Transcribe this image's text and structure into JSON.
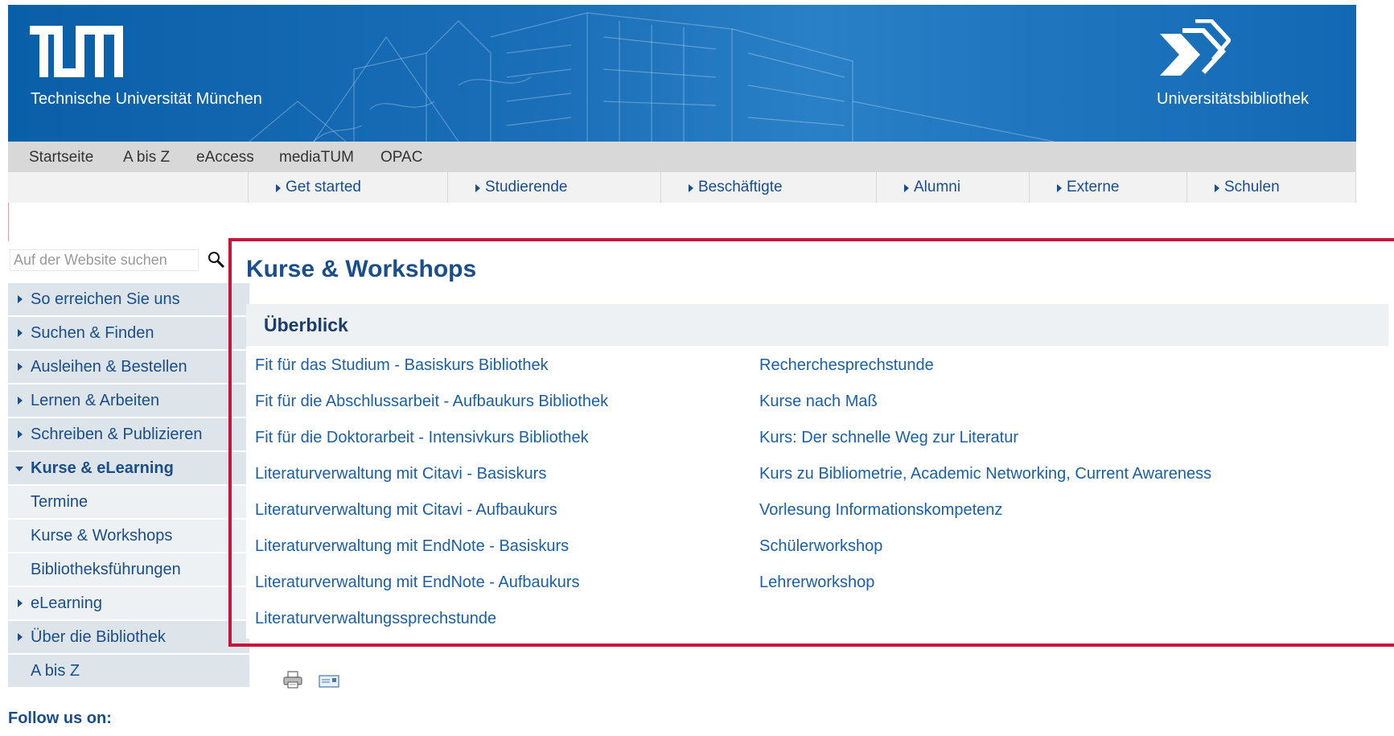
{
  "header": {
    "logo_text": "TUM",
    "university_name": "Technische Universität München",
    "library_name": "Universitätsbibliothek"
  },
  "topnav": [
    "Startseite",
    "A bis Z",
    "eAccess",
    "mediaTUM",
    "OPAC"
  ],
  "audience_nav": [
    "Get started",
    "Studierende",
    "Beschäftigte",
    "Alumni",
    "Externe",
    "Schulen"
  ],
  "search": {
    "placeholder": "Auf der Website suchen"
  },
  "sidebar": {
    "items": [
      {
        "label": "So erreichen Sie uns"
      },
      {
        "label": "Suchen & Finden"
      },
      {
        "label": "Ausleihen & Bestellen"
      },
      {
        "label": "Lernen & Arbeiten"
      },
      {
        "label": "Schreiben & Publizieren"
      },
      {
        "label": "Kurse & eLearning"
      },
      {
        "label": "Termine"
      },
      {
        "label": "Kurse & Workshops"
      },
      {
        "label": "Bibliotheksführungen"
      },
      {
        "label": "eLearning"
      },
      {
        "label": "Über die Bibliothek"
      },
      {
        "label": "A bis Z"
      }
    ],
    "follow_label": "Follow us on:"
  },
  "content": {
    "title": "Kurse & Workshops",
    "overview_heading": "Überblick",
    "column1": [
      "Fit für das Studium - Basiskurs Bibliothek",
      "Fit für die Abschlussarbeit - Aufbaukurs Bibliothek",
      "Fit für die Doktorarbeit - Intensivkurs Bibliothek",
      "Literaturverwaltung mit Citavi - Basiskurs",
      "Literaturverwaltung mit Citavi - Aufbaukurs",
      "Literaturverwaltung mit EndNote - Basiskurs",
      "Literaturverwaltung mit EndNote - Aufbaukurs",
      "Literaturverwaltungssprechstunde"
    ],
    "column2": [
      "Recherchesprechstunde",
      "Kurse nach Maß",
      "Kurs: Der schnelle Weg zur Literatur",
      "Kurs zu Bibliometrie, Academic Networking, Current Awareness",
      "Vorlesung Informationskompetenz",
      "Schülerworkshop",
      "Lehrerworkshop"
    ]
  },
  "colors": {
    "brand_blue": "#1a4d8c",
    "link_blue": "#1a5fa8",
    "highlight_red": "#c8143c"
  },
  "icons": [
    "search-icon",
    "print-icon",
    "email-icon",
    "tum-logo",
    "ub-logo"
  ]
}
